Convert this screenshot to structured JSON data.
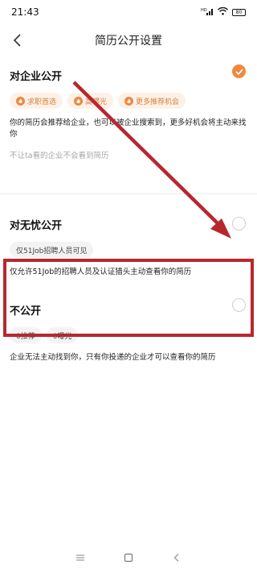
{
  "status_bar": {
    "time": "21:43",
    "signal_label": "HD",
    "battery_label": "80"
  },
  "nav": {
    "title": "简历公开设置"
  },
  "options": [
    {
      "title": "对企业公开",
      "checked": true,
      "tags": [
        "求职首选",
        "高曝光",
        "更多推荐机会"
      ],
      "desc": "你的简历会推荐给企业，也可以被企业搜索到，更多好机会将主动来找你",
      "link": "不让ta看的企业不会看到简历"
    },
    {
      "title": "对无忧公开",
      "checked": false,
      "tags": [
        "仅51Job招聘人员可见"
      ],
      "desc": "仅允许51Job的招聘人员及认证猎头主动查看你的简历"
    },
    {
      "title": "不公开",
      "checked": false,
      "tags": [
        "0推荐",
        "0曝光"
      ],
      "desc": "企业无法主动找到你，只有你投递的企业才可以查看你的简历"
    }
  ],
  "colors": {
    "accent": "#f0883e",
    "annotation": "#b7282e"
  },
  "icons": {
    "back": "chevron-left-icon",
    "check": "check-icon",
    "tag": "flame-icon",
    "home_nav": [
      "menu-icon",
      "square-icon",
      "back-triangle-icon"
    ]
  }
}
